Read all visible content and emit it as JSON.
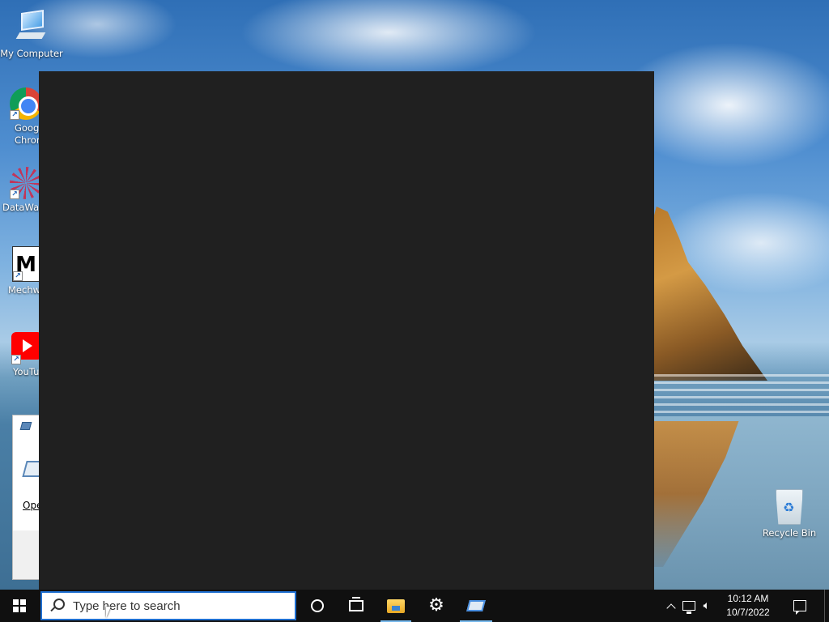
{
  "desktop": {
    "icons": [
      {
        "label": "My Computer",
        "icon": "computer-icon"
      },
      {
        "label": "Goog\nChrom",
        "icon": "chrome-icon"
      },
      {
        "label": "DataWag",
        "icon": "datawagon-icon"
      },
      {
        "label": "Mechw",
        "icon": "mechwarrior-icon",
        "glyph_text": "M"
      },
      {
        "label": "YouTu",
        "icon": "youtube-icon"
      },
      {
        "label": "Recycle Bin",
        "icon": "recycle-bin-icon"
      }
    ]
  },
  "side_window": {
    "open_label": "Ope"
  },
  "taskbar": {
    "search_placeholder": "Type here to search",
    "apps": [
      {
        "name": "cortana",
        "icon": "cortana-icon"
      },
      {
        "name": "task-view",
        "icon": "task-view-icon"
      },
      {
        "name": "file-explorer",
        "icon": "folder-icon",
        "active": true
      },
      {
        "name": "settings",
        "icon": "gear-icon",
        "glyph": "⚙"
      },
      {
        "name": "app",
        "icon": "app-window-icon",
        "active": true
      }
    ],
    "clock": {
      "time": "10:12 AM",
      "date": "10/7/2022"
    }
  },
  "colors": {
    "taskbar_bg": "#101010",
    "dark_window_bg": "#202020",
    "accent": "#1f6fd1",
    "active_indicator": "#76b9ed"
  }
}
